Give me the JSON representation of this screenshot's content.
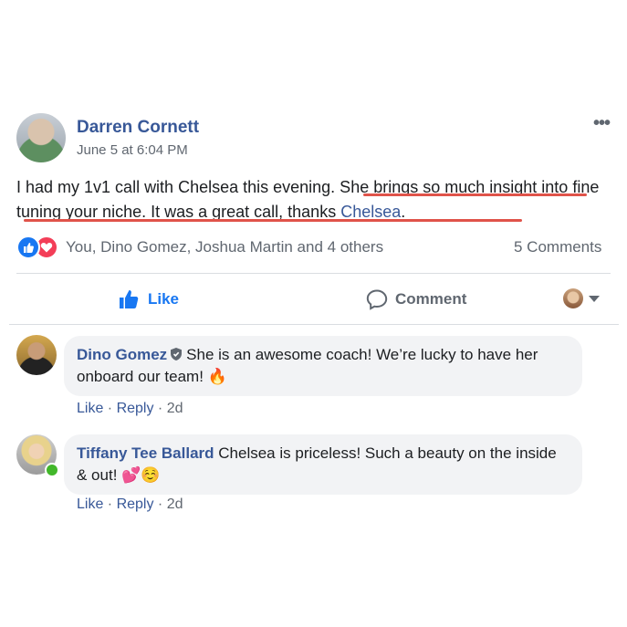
{
  "post": {
    "author": "Darren Cornett",
    "timestamp": "June 5 at 6:04 PM",
    "more_icon": "more-horizontal-icon",
    "text_part1": "I had my 1v1 call with Chelsea this evening. She brings so much insight into fine tuning your niche. It was a great call, thanks ",
    "mention": "Chelsea",
    "text_end": "."
  },
  "reactions": {
    "icons": [
      "like-reaction-icon",
      "love-reaction-icon"
    ],
    "reactors_text": "You, Dino Gomez, Joshua Martin and 4 others",
    "comments_count": "5 Comments"
  },
  "actions": {
    "like_label": "Like",
    "comment_label": "Comment"
  },
  "comments": [
    {
      "author": "Dino Gomez",
      "badge_icon": "shield-icon",
      "text": "She is an awesome coach! We’re lucky to have her onboard our team! ",
      "emoji": "🔥",
      "like_label": "Like",
      "reply_label": "Reply",
      "time": "2d"
    },
    {
      "author": "Tiffany Tee Ballard",
      "text": "Chelsea is priceless! Such a beauty on the inside & out! ",
      "emoji": "💕☺️",
      "like_label": "Like",
      "reply_label": "Reply",
      "time": "2d"
    }
  ],
  "colors": {
    "link_blue": "#385898",
    "like_blue": "#1877f2",
    "love_red": "#f33e58",
    "annotation_red": "#e0534a",
    "secondary_text": "#606770",
    "bubble_bg": "#f2f3f5"
  }
}
